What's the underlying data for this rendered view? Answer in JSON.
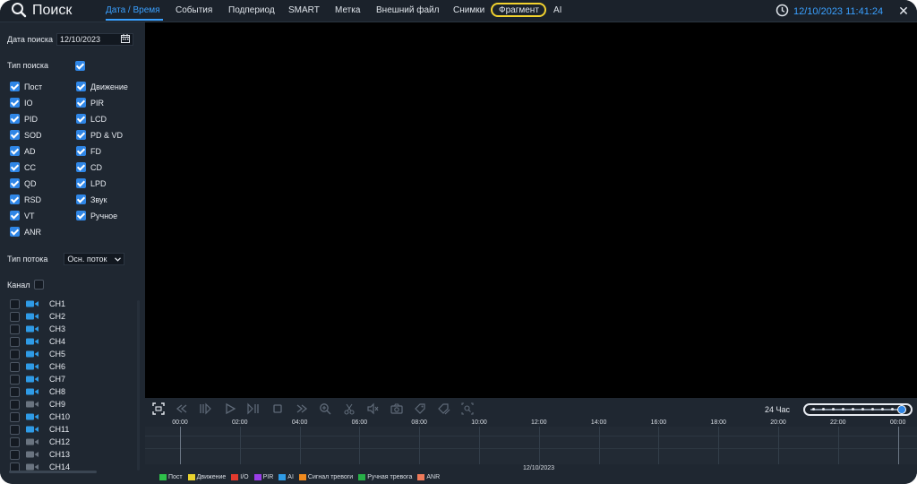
{
  "header": {
    "title": "Поиск",
    "tabs": [
      {
        "label": "Дата / Время",
        "active": true
      },
      {
        "label": "События"
      },
      {
        "label": "Подпериод"
      },
      {
        "label": "SMART"
      },
      {
        "label": "Метка"
      },
      {
        "label": "Внешний файл"
      },
      {
        "label": "Снимки"
      },
      {
        "label": "Фрагмент",
        "highlighted": true
      },
      {
        "label": "AI"
      }
    ],
    "datetime": "12/10/2023 11:41:24"
  },
  "sidebar": {
    "search_date_label": "Дата поиска",
    "search_date_value": "12/10/2023",
    "search_type_label": "Тип поиска",
    "types_left": [
      "Пост",
      "IO",
      "PID",
      "SOD",
      "AD",
      "CC",
      "QD",
      "RSD",
      "VT",
      "ANR"
    ],
    "types_right": [
      "Движение",
      "PIR",
      "LCD",
      "PD & VD",
      "FD",
      "CD",
      "LPD",
      "Звук",
      "Ручное"
    ],
    "stream_type_label": "Тип потока",
    "stream_type_value": "Осн. поток",
    "channel_label": "Канал",
    "channels": [
      "CH1",
      "CH2",
      "CH3",
      "CH4",
      "CH5",
      "CH6",
      "CH7",
      "CH8",
      "CH9",
      "CH10",
      "CH11",
      "CH12",
      "CH13",
      "CH14"
    ],
    "channel_online": [
      true,
      true,
      true,
      true,
      true,
      true,
      true,
      true,
      false,
      true,
      true,
      false,
      false,
      false
    ]
  },
  "playback": {
    "timeline_hours": [
      "00:00",
      "02:00",
      "04:00",
      "06:00",
      "08:00",
      "10:00",
      "12:00",
      "14:00",
      "16:00",
      "18:00",
      "20:00",
      "22:00",
      "00:00"
    ],
    "range_label": "24 Час",
    "timeline_date": "12/10/2023",
    "legend": [
      {
        "label": "Пост",
        "color": "#2ec04a"
      },
      {
        "label": "Движение",
        "color": "#e8d22e"
      },
      {
        "label": "I/O",
        "color": "#e23a2e"
      },
      {
        "label": "PIR",
        "color": "#9a3ee8"
      },
      {
        "label": "AI",
        "color": "#2f9be6"
      },
      {
        "label": "Сигнал тревоги",
        "color": "#f08a1e"
      },
      {
        "label": "Ручная тревога",
        "color": "#28b048"
      },
      {
        "label": "ANR",
        "color": "#ef7a5a"
      }
    ]
  },
  "colors": {
    "accent": "#3aa0ff",
    "highlight": "#f2d22e",
    "checkbox": "#2f86e6"
  }
}
